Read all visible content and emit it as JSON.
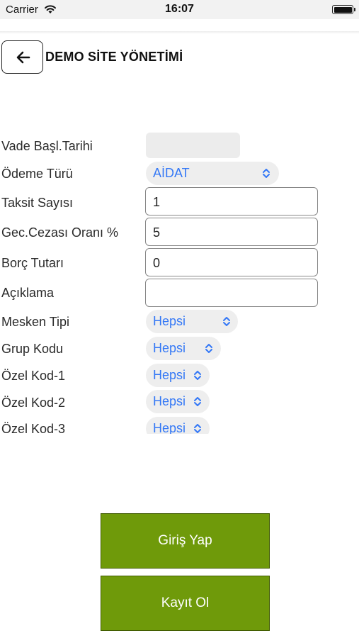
{
  "status_bar": {
    "carrier": "Carrier",
    "time": "16:07"
  },
  "header": {
    "title": "DEMO SİTE YÖNETİMİ"
  },
  "form": {
    "vade_label": "Vade Başl.Tarihi",
    "odeme_turu_label": "Ödeme Türü",
    "odeme_turu_value": "AİDAT",
    "taksit_label": "Taksit Sayısı",
    "taksit_value": "1",
    "gecikme_label": "Gec.Cezası Oranı %",
    "gecikme_value": "5",
    "borc_label": "Borç Tutarı",
    "borc_value": "0",
    "aciklama_label": "Açıklama",
    "aciklama_value": "",
    "mesken_label": "Mesken Tipi",
    "mesken_value": "Hepsi",
    "grup_label": "Grup Kodu",
    "grup_value": "Hepsi",
    "ozel1_label": "Özel Kod-1",
    "ozel1_value": "Hepsi",
    "ozel2_label": "Özel Kod-2",
    "ozel2_value": "Hepsi",
    "ozel3_label": "Özel Kod-3",
    "ozel3_value": "Hepsi"
  },
  "buttons": {
    "login": "Giriş Yap",
    "register": "Kayıt Ol"
  },
  "colors": {
    "accent": "#3478f6",
    "button_green": "#6f9a0a",
    "button_border": "#3f5a00"
  },
  "icons": {
    "back": "arrow-left-icon",
    "picker": "chevron-up-down-icon",
    "wifi": "wifi-icon",
    "battery": "battery-icon"
  }
}
